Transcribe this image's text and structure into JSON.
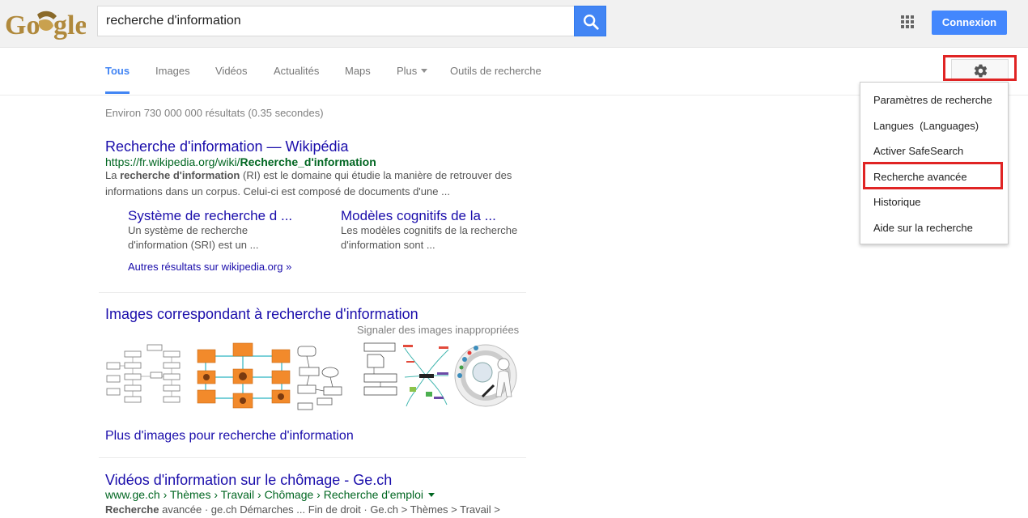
{
  "search": {
    "query": "recherche d'information"
  },
  "header": {
    "login_label": "Connexion"
  },
  "tabs": [
    {
      "label": "Tous",
      "active": true
    },
    {
      "label": "Images"
    },
    {
      "label": "Vidéos"
    },
    {
      "label": "Actualités"
    },
    {
      "label": "Maps"
    },
    {
      "label": "Plus"
    },
    {
      "label": "Outils de recherche"
    }
  ],
  "settings_menu": {
    "items": [
      "Paramètres de recherche",
      "Langues  (Languages)",
      "Activer SafeSearch",
      "Recherche avancée",
      "Historique",
      "Aide sur la recherche"
    ],
    "highlighted": "Recherche avancée"
  },
  "stats": "Environ 730 000 000 résultats (0.35 secondes)",
  "results": {
    "wiki": {
      "title": "Recherche d'information — Wikipédia",
      "url_prefix": "https://fr.wikipedia.org/wiki/",
      "url_bold": "Recherche_d'information",
      "snippet_pre": "La ",
      "snippet_bold": "recherche d'information",
      "snippet_post": " (RI) est le domaine qui étudie la manière de retrouver des",
      "snippet_line2": "informations dans un corpus. Celui-ci est composé de documents d'une ...",
      "sublinks": [
        {
          "title": "Système de recherche d ...",
          "line1": "Un système de recherche",
          "line2": "d'information (SRI) est un ..."
        },
        {
          "title": "Modèles cognitifs de la ...",
          "line1": "Les modèles cognitifs de la recherche",
          "line2": "d'information sont ..."
        }
      ],
      "more": "Autres résultats sur wikipedia.org »"
    },
    "images": {
      "title": "Images correspondant à recherche d'information",
      "report": "Signaler des images inappropriées",
      "more": "Plus d'images pour recherche d'information"
    },
    "videos": {
      "title": "Vidéos d'information sur le chômage - Ge.ch",
      "url": "www.ge.ch › Thèmes › Travail › Chômage › Recherche d'emploi",
      "snippet_bold": "Recherche",
      "snippet_rest": " avancée · ge.ch Démarches ... Fin de droit · Ge.ch > Thèmes > Travail >"
    }
  },
  "colors": {
    "accent": "#4285f4",
    "highlight_box": "#e02424",
    "link": "#1a0dab",
    "url": "#006621"
  }
}
